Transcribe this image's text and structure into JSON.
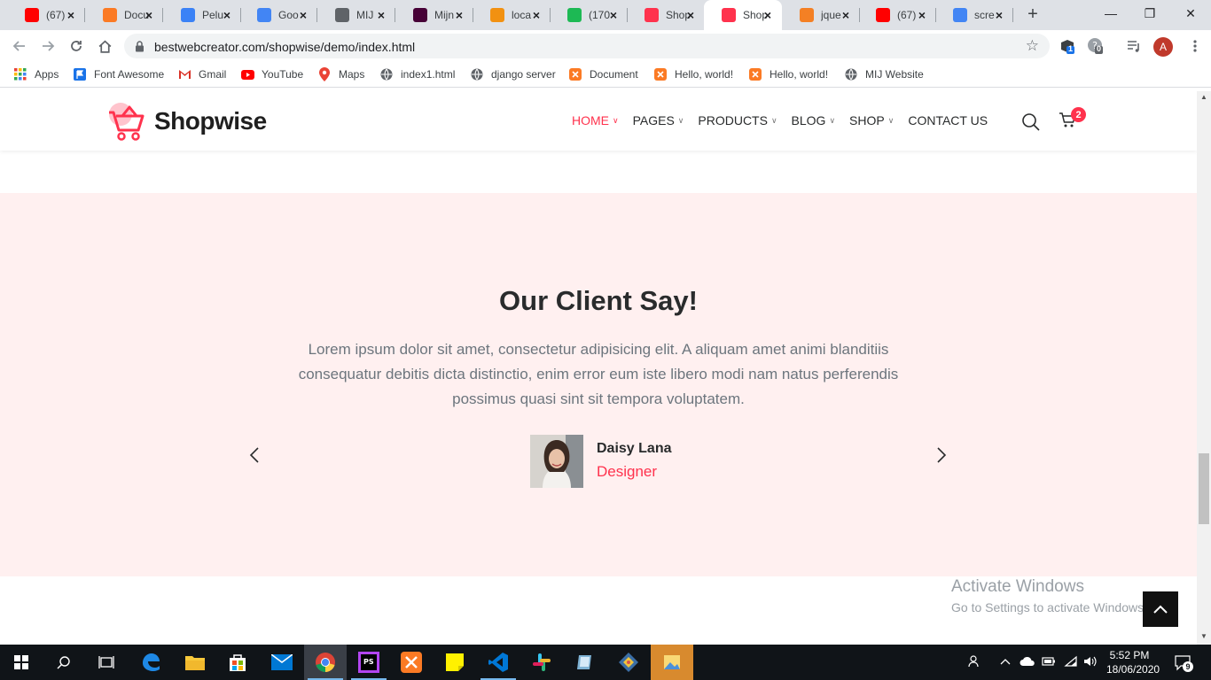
{
  "browser": {
    "tabs": [
      {
        "title": "(67)",
        "favicon": "youtube-icon",
        "color": "#ff0000"
      },
      {
        "title": "Docu",
        "favicon": "xampp-icon",
        "color": "#fb7a24"
      },
      {
        "title": "Pelu",
        "favicon": "shield-icon",
        "color": "#3b82f6"
      },
      {
        "title": "Goo",
        "favicon": "google-icon",
        "color": "#4285f4"
      },
      {
        "title": "MIJ",
        "favicon": "globe-icon",
        "color": "#5f6368"
      },
      {
        "title": "Mijn",
        "favicon": "adobe-xd-icon",
        "color": "#470137"
      },
      {
        "title": "loca",
        "favicon": "phpmyadmin-icon",
        "color": "#f29111"
      },
      {
        "title": "(170",
        "favicon": "badge-99-icon",
        "color": "#1db954"
      },
      {
        "title": "Shop",
        "favicon": "cart-icon",
        "color": "#ff324d"
      },
      {
        "title": "Shop",
        "favicon": "cart-icon",
        "color": "#ff324d"
      },
      {
        "title": "jque",
        "favicon": "stackoverflow-icon",
        "color": "#f48024"
      },
      {
        "title": "(67)",
        "favicon": "youtube-icon",
        "color": "#ff0000"
      },
      {
        "title": "scre",
        "favicon": "google-icon",
        "color": "#4285f4"
      }
    ],
    "active_tab_index": 9,
    "url": "bestwebcreator.com/shopwise/demo/index.html",
    "profile_initial": "A",
    "extension_badges": [
      "1",
      "0"
    ],
    "bookmarks": [
      {
        "label": "Apps",
        "icon": "apps-grid-icon"
      },
      {
        "label": "Font Awesome",
        "icon": "flag-icon"
      },
      {
        "label": "Gmail",
        "icon": "gmail-icon"
      },
      {
        "label": "YouTube",
        "icon": "youtube-icon"
      },
      {
        "label": "Maps",
        "icon": "maps-pin-icon"
      },
      {
        "label": "index1.html",
        "icon": "globe-icon"
      },
      {
        "label": "django server",
        "icon": "globe-icon"
      },
      {
        "label": "Document",
        "icon": "xampp-icon"
      },
      {
        "label": "Hello, world!",
        "icon": "xampp-icon"
      },
      {
        "label": "Hello, world!",
        "icon": "xampp-icon"
      },
      {
        "label": "MIJ Website",
        "icon": "globe-icon"
      }
    ]
  },
  "site": {
    "logo_text": "Shopwise",
    "nav": [
      {
        "label": "HOME",
        "dropdown": true,
        "active": true
      },
      {
        "label": "PAGES",
        "dropdown": true
      },
      {
        "label": "PRODUCTS",
        "dropdown": true
      },
      {
        "label": "BLOG",
        "dropdown": true
      },
      {
        "label": "SHOP",
        "dropdown": true
      },
      {
        "label": "CONTACT US",
        "dropdown": false
      }
    ],
    "cart_count": "2",
    "accent_color": "#ff324d",
    "section_bg": "#fff0f0"
  },
  "testimonial": {
    "title": "Our Client Say!",
    "quote": "Lorem ipsum dolor sit amet, consectetur adipisicing elit. A aliquam amet animi blanditiis consequatur debitis dicta distinctio, enim error eum iste libero modi nam natus perferendis possimus quasi sint sit tempora voluptatem.",
    "name": "Daisy Lana",
    "role": "Designer"
  },
  "watermark": {
    "line1": "Activate Windows",
    "line2": "Go to Settings to activate Windows."
  },
  "taskbar": {
    "time": "5:52 PM",
    "date": "18/06/2020",
    "notifications": "9"
  }
}
